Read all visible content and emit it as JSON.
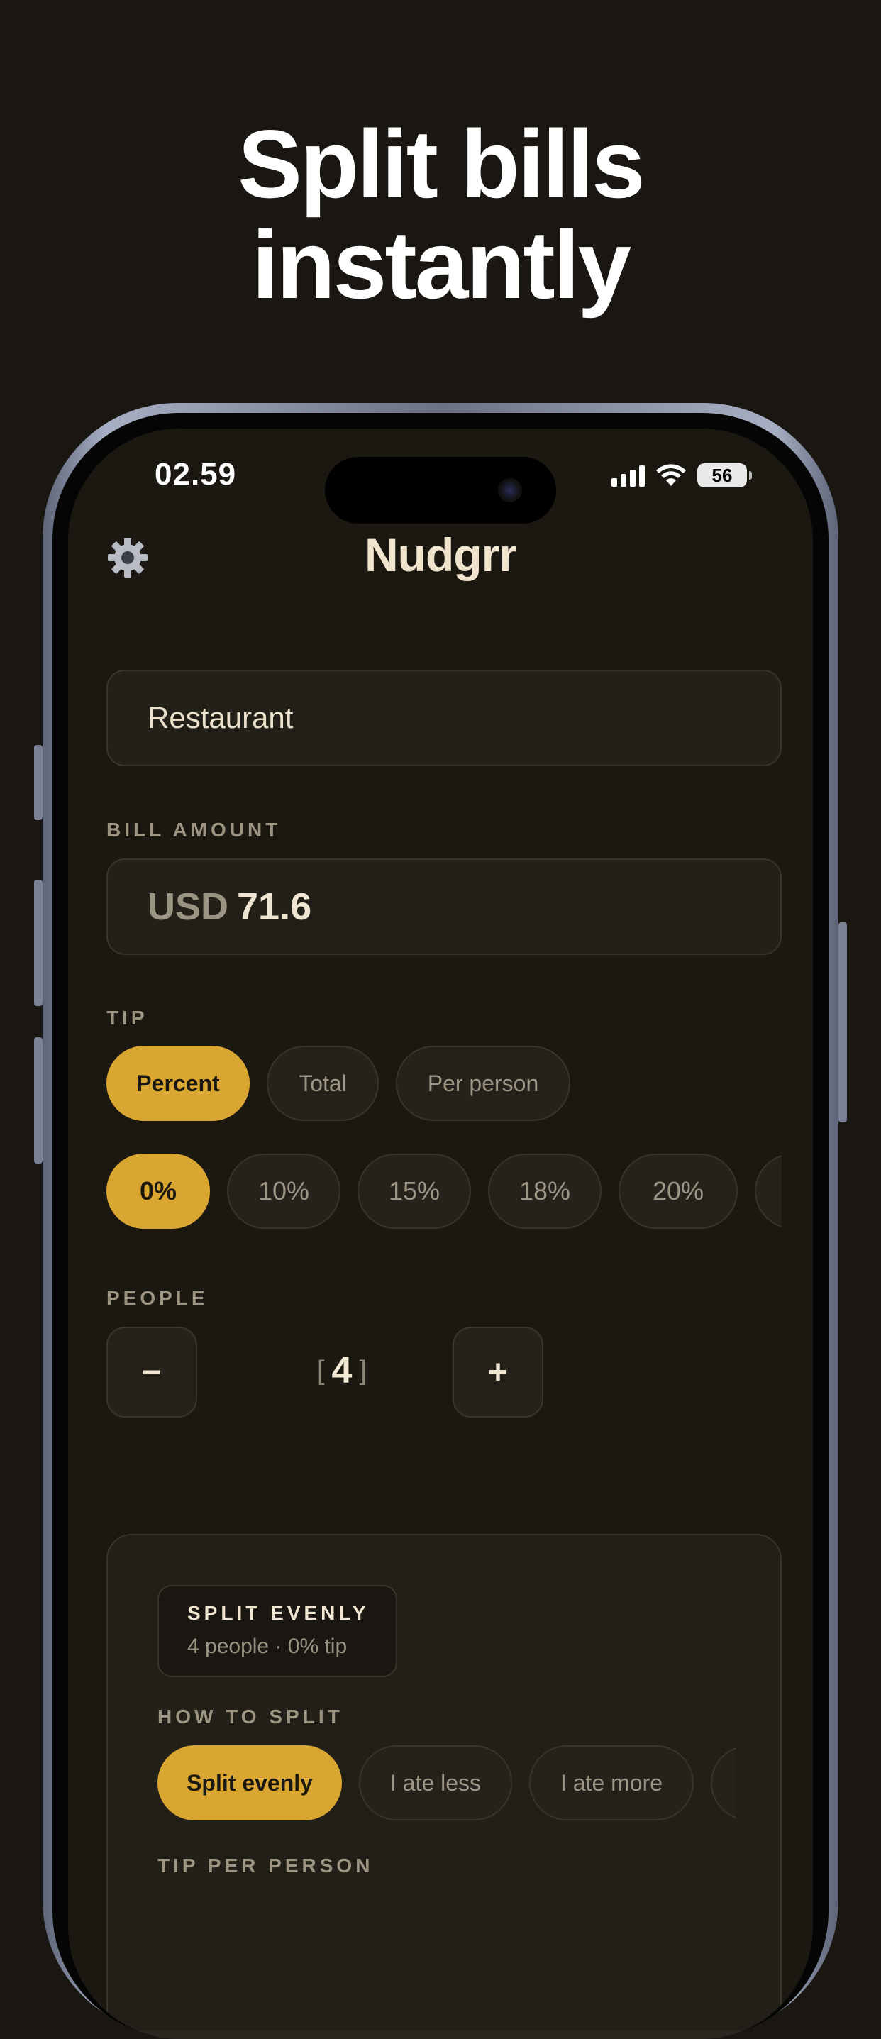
{
  "headline": {
    "line1": "Split bills",
    "line2": "instantly"
  },
  "status": {
    "time": "02.59",
    "battery": "56"
  },
  "app": {
    "title": "Nudgrr"
  },
  "merchant": {
    "value": "Restaurant"
  },
  "bill": {
    "label": "BILL AMOUNT",
    "currency": "USD",
    "amount": "71.6"
  },
  "tip": {
    "label": "TIP",
    "modes": [
      "Percent",
      "Total",
      "Per person"
    ],
    "active_mode": "Percent",
    "percents": [
      "0%",
      "10%",
      "15%",
      "18%",
      "20%"
    ],
    "active_percent": "0%"
  },
  "people": {
    "label": "PEOPLE",
    "minus": "−",
    "plus": "+",
    "count": "4",
    "open_bracket": "[",
    "close_bracket": "]"
  },
  "summary": {
    "badge_title": "SPLIT EVENLY",
    "badge_sub": "4 people · 0% tip",
    "how_label": "HOW TO SPLIT",
    "split_options": [
      "Split evenly",
      "I ate less",
      "I ate more"
    ],
    "active_split": "Split evenly",
    "tip_per_person_label": "TIP PER PERSON"
  },
  "colors": {
    "accent": "#d9a632",
    "background": "#1a1712",
    "surface": "#23201a"
  }
}
